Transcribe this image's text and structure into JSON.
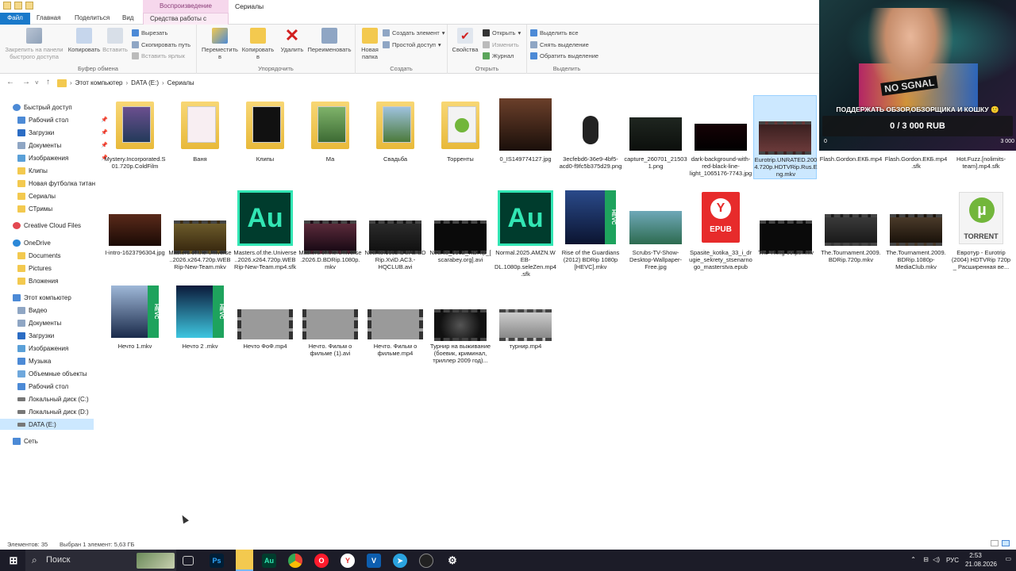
{
  "titlebar": {
    "context_group": "Воспроизведение",
    "window_title": "Сериалы"
  },
  "tabs": [
    {
      "label": "Файл"
    },
    {
      "label": "Главная"
    },
    {
      "label": "Поделиться"
    },
    {
      "label": "Вид"
    },
    {
      "label": "Средства работы с видео"
    }
  ],
  "ribbon": {
    "clipboard": {
      "label": "Буфер обмена",
      "pin": "Закрепить на панели быстрого доступа",
      "copy": "Копировать",
      "paste": "Вставить",
      "cut": "Вырезать",
      "copy_path": "Скопировать путь",
      "paste_shortcut": "Вставить ярлык"
    },
    "organize": {
      "label": "Упорядочить",
      "move": "Переместить в",
      "copy_to": "Копировать в",
      "delete": "Удалить",
      "rename": "Переименовать"
    },
    "create": {
      "label": "Создать",
      "new_folder": "Новая папка",
      "new_item": "Создать элемент",
      "easy_access": "Простой доступ"
    },
    "open": {
      "label": "Открыть",
      "properties": "Свойства",
      "open": "Открыть",
      "edit": "Изменить",
      "history": "Журнал"
    },
    "select": {
      "label": "Выделить",
      "select_all": "Выделить все",
      "select_none": "Снять выделение",
      "invert": "Обратить выделение"
    }
  },
  "address": {
    "parts": [
      "Этот компьютер",
      "DATA (E:)",
      "Сериалы"
    ]
  },
  "nav": {
    "quick_access": "Быстрый доступ",
    "items": [
      {
        "label": "Рабочий стол"
      },
      {
        "label": "Загрузки"
      },
      {
        "label": "Документы"
      },
      {
        "label": "Изображения"
      },
      {
        "label": "Клипы"
      },
      {
        "label": "Новая футболка титан"
      },
      {
        "label": "Сериалы"
      },
      {
        "label": "СТримы"
      }
    ],
    "creative_cloud": "Creative Cloud Files",
    "onedrive": "OneDrive",
    "onedrive_items": [
      {
        "label": "Documents"
      },
      {
        "label": "Pictures"
      },
      {
        "label": "Вложения"
      }
    ],
    "this_pc": "Этот компьютер",
    "pc_items": [
      {
        "label": "Видео"
      },
      {
        "label": "Документы"
      },
      {
        "label": "Загрузки"
      },
      {
        "label": "Изображения"
      },
      {
        "label": "Музыка"
      },
      {
        "label": "Объемные объекты"
      },
      {
        "label": "Рабочий стол"
      },
      {
        "label": "Локальный диск (C:)"
      },
      {
        "label": "Локальный диск (D:)"
      },
      {
        "label": "DATA (E:)"
      }
    ],
    "network": "Сеть"
  },
  "files": [
    {
      "name": "Mystery.Incorporated.S01.720p.ColdFilm",
      "kind": "folder"
    },
    {
      "name": "Ваня",
      "kind": "folder"
    },
    {
      "name": "Клипы",
      "kind": "folder"
    },
    {
      "name": "Ма",
      "kind": "folder"
    },
    {
      "name": "Свадьба",
      "kind": "folder"
    },
    {
      "name": "Торренты",
      "kind": "folder"
    },
    {
      "name": "0_IS149774127.jpg",
      "kind": "image"
    },
    {
      "name": "3ecfebd6-36e9-4bf5-acd0-f9fc5b375d29.png",
      "kind": "image"
    },
    {
      "name": "capture_260701_215031.png",
      "kind": "image"
    },
    {
      "name": "dark-background-with-red-black-line-light_1065176-7743.jpg",
      "kind": "image"
    },
    {
      "name": "Eurotrip.UNRATED.2004.720p.HDTVRip.Rus.Eng.mkv",
      "kind": "video"
    },
    {
      "name": "Flash.Gordon.ЕКБ.mp4",
      "kind": "video"
    },
    {
      "name": "Flash.Gordon.ЕКБ.mp4.sfk",
      "kind": "video"
    },
    {
      "name": "Hot.Fuzz.[nolimits-team].mp4.sfk",
      "kind": "video"
    },
    {
      "name": "I-intro-1623796304.jpg",
      "kind": "image"
    },
    {
      "name": "Masters.of.the.Universe..2026.x264.720p.WEBRip-New-Team.mkv",
      "kind": "video"
    },
    {
      "name": "Masters.of.the.Universe..2026.x264.720p.WEBRip-New-Team.mp4.sfk",
      "kind": "audition"
    },
    {
      "name": "Masters.of.the.Universe.2026.D.BDRip.1080p.mkv",
      "kind": "video"
    },
    {
      "name": "Nechto.1982.DUAL.BDRip.XviD.AC3.-HQCLUB.avi",
      "kind": "video"
    },
    {
      "name": "Nechto_1982_HDRip_[scarabey.org].avi",
      "kind": "video"
    },
    {
      "name": "Normal.2025.AMZN.WEB-DL.1080p.seleZen.mp4.sfk",
      "kind": "audition"
    },
    {
      "name": "Rise of the Guardians (2012) BDRip 1080p [HEVC].mkv",
      "kind": "hevc"
    },
    {
      "name": "Scrubs-TV-Show-Desktop-Wallpaper-Free.jpg",
      "kind": "image"
    },
    {
      "name": "Spasite_kotika_33_i_drugie_sekrety_stsenarnogo_masterstva.epub",
      "kind": "epub"
    },
    {
      "name": "The Thing 60fps.mkv",
      "kind": "video"
    },
    {
      "name": "The.Tournament.2009.BDRip.720p.mkv",
      "kind": "video"
    },
    {
      "name": "The.Tournament.2009.BDRip.1080p-MediaClub.mkv",
      "kind": "video"
    },
    {
      "name": "Евротур - Eurotrip (2004) HDTVRip 720p _ Расширенная ве...",
      "kind": "torrent"
    },
    {
      "name": "Нечто 1.mkv",
      "kind": "hevc"
    },
    {
      "name": "Нечто 2 .mkv",
      "kind": "hevc"
    },
    {
      "name": "Нечто ФоФ.mp4",
      "kind": "film"
    },
    {
      "name": "Нечто. Фильм о фильме (1).avi",
      "kind": "film"
    },
    {
      "name": "Нечто. Фильм о фильме.mp4",
      "kind": "film"
    },
    {
      "name": "Турнир на выживание (боевик, криминал, триллер 2009 год)...",
      "kind": "video"
    },
    {
      "name": "турнир.mp4",
      "kind": "video"
    }
  ],
  "icons": {
    "au_text": "Au",
    "hevc_text": "HEVC",
    "epub_text": "EPUB",
    "torrent_text": "TORRENT"
  },
  "status": {
    "count": "Элементов: 35",
    "selected": "Выбран 1 элемент: 5,63 ГБ"
  },
  "taskbar": {
    "search": "Поиск",
    "lang": "РУС",
    "time": "2:53",
    "date": "21.08.2026"
  },
  "webcam": {
    "overlay_text": "NO SGNAL",
    "donate_title": "ПОДДЕРЖАТЬ ОБЗОР,ОБЗОРЩИКА И КОШКУ 🙂",
    "donate_amount": "0 / 3 000 RUB",
    "min": "0",
    "max": "3 000",
    "donate_progress": 0
  },
  "colors": {
    "file_tab": "#1979ca",
    "selection": "#cce8ff",
    "folder": "#f3c94f",
    "audition": "#32e6b4",
    "taskbar": "#1c1c28"
  }
}
